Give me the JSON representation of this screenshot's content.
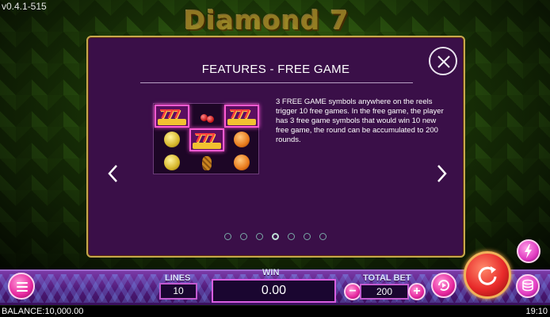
{
  "version": "v0.4.1-515",
  "logo": "Diamond 7",
  "dialog": {
    "title": "FEATURES - FREE GAME",
    "description": "3 FREE GAME symbols anywhere on the reels trigger 10 free games. In the free game, the player has 3 free game symbols that would win 10 new free game, the round can be accumulated to 200 rounds.",
    "reel_symbols": [
      [
        "free-game",
        "cherry",
        "free-game"
      ],
      [
        "lemon",
        "free-game",
        "orange"
      ],
      [
        "lemon",
        "pineapple",
        "orange"
      ]
    ],
    "symbol_text": {
      "sevens": "777",
      "free_game": "FREEGAME"
    },
    "page_count": 7,
    "current_page": 4
  },
  "controls": {
    "lines_label": "LINES",
    "lines_value": "10",
    "win_label": "WIN",
    "win_value": "0.00",
    "total_bet_label": "TOTAL BET",
    "total_bet_value": "200",
    "minus": "−",
    "plus": "+"
  },
  "status": {
    "balance": "BALANCE:10,000.00",
    "time": "19:10"
  },
  "colors": {
    "panel": "#3a0f48",
    "panel_border": "#c7a84d",
    "accent_pink": "#e6279e",
    "spin_red": "#e82a2a"
  }
}
